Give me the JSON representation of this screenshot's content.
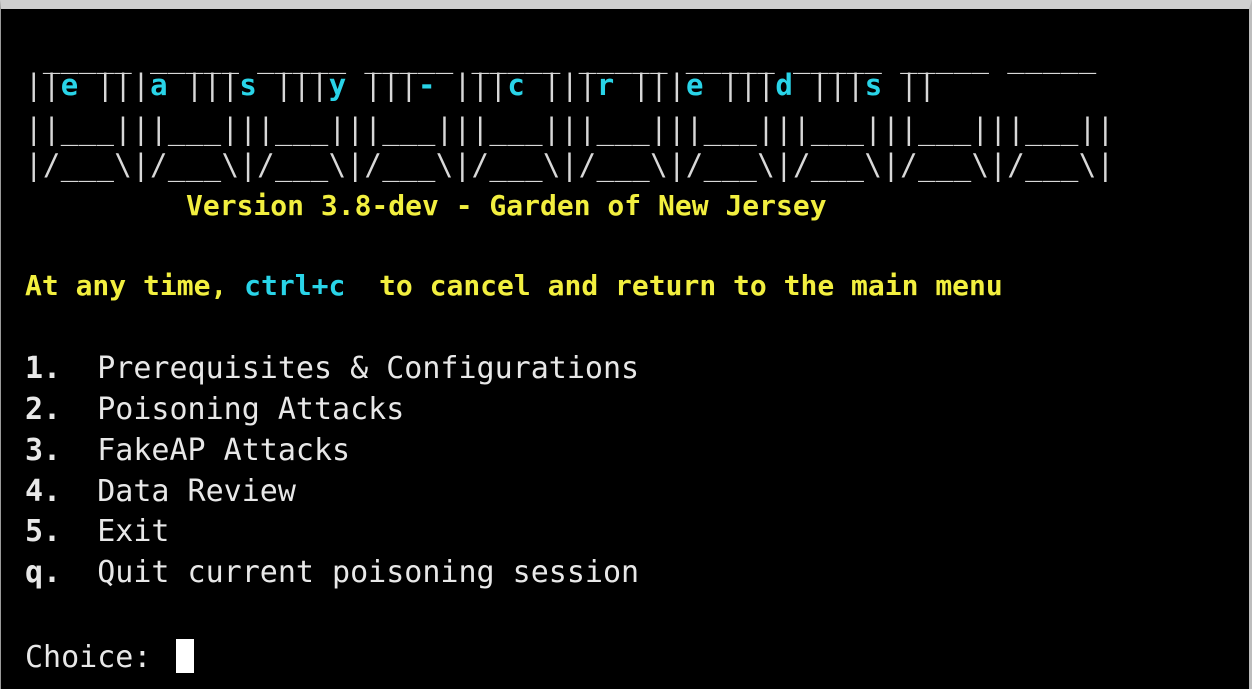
{
  "banner": {
    "line1": " _____ _____ _____ _____ _____ _____ _____ _____ _____ _____",
    "letters": [
      "e",
      "a",
      "s",
      "y",
      "-",
      "c",
      "r",
      "e",
      "d",
      "s"
    ],
    "line3": "||___|||___|||___|||___|||___|||___|||___|||___|||___|||___||",
    "line4": "|/___\\|/___\\|/___\\|/___\\|/___\\|/___\\|/___\\|/___\\|/___\\|/___\\|"
  },
  "version_text": "Version 3.8-dev - Garden of New Jersey",
  "cancel_hint": {
    "prefix": "At any time, ",
    "key": "ctrl+c",
    "suffix": "  to cancel and return to the main menu"
  },
  "menu": [
    {
      "key": "1.",
      "label": "Prerequisites & Configurations"
    },
    {
      "key": "2.",
      "label": "Poisoning Attacks"
    },
    {
      "key": "3.",
      "label": "FakeAP Attacks"
    },
    {
      "key": "4.",
      "label": "Data Review"
    },
    {
      "key": "5.",
      "label": "Exit"
    },
    {
      "key": "q.",
      "label": "Quit current poisoning session"
    }
  ],
  "prompt_label": "Choice: ",
  "colors": {
    "background": "#000000",
    "text": "#e8e8e8",
    "accent_cyan": "#29d4e8",
    "accent_yellow": "#f2ef3f"
  }
}
